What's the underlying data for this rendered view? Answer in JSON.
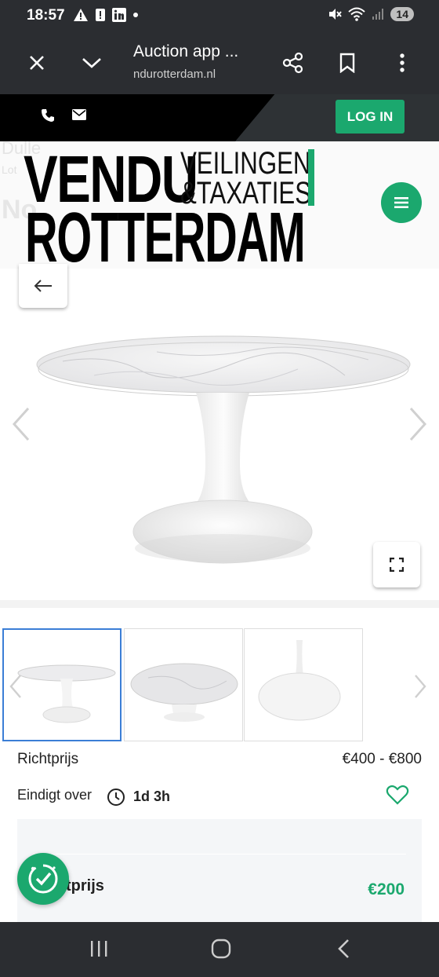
{
  "status": {
    "time": "18:57",
    "left_icons": [
      "warning-icon",
      "alert-icon",
      "linkedin-icon",
      "dot-icon"
    ],
    "right_icons": [
      "mute-icon",
      "wifi-icon",
      "signal-icon"
    ],
    "battery": "14"
  },
  "browser": {
    "title": "Auction app ...",
    "url": "ndurotterdam.nl",
    "icons": [
      "close-icon",
      "chevron-down-icon",
      "share-icon",
      "bookmark-icon",
      "more-icon"
    ]
  },
  "site": {
    "login_label": "LOG IN",
    "logo": {
      "line1": "VENDU",
      "line2": "ROTTERDAM",
      "tag1": "VEILINGEN",
      "tag2": "&TAXATIES"
    },
    "ghost_title": "Dulle",
    "ghost_lot": "Lot",
    "ghost_name": "No"
  },
  "colors": {
    "accent": "#1ba86e",
    "dark": "#2b2d31",
    "selected_border": "#3b7ed6"
  },
  "lot": {
    "price_label": "Richtprijs",
    "price_value": "€400 - €800",
    "ends_label": "Eindigt over",
    "ends_value": "1d 3h",
    "bid_label": "tprijs",
    "bid_value": "€200"
  }
}
